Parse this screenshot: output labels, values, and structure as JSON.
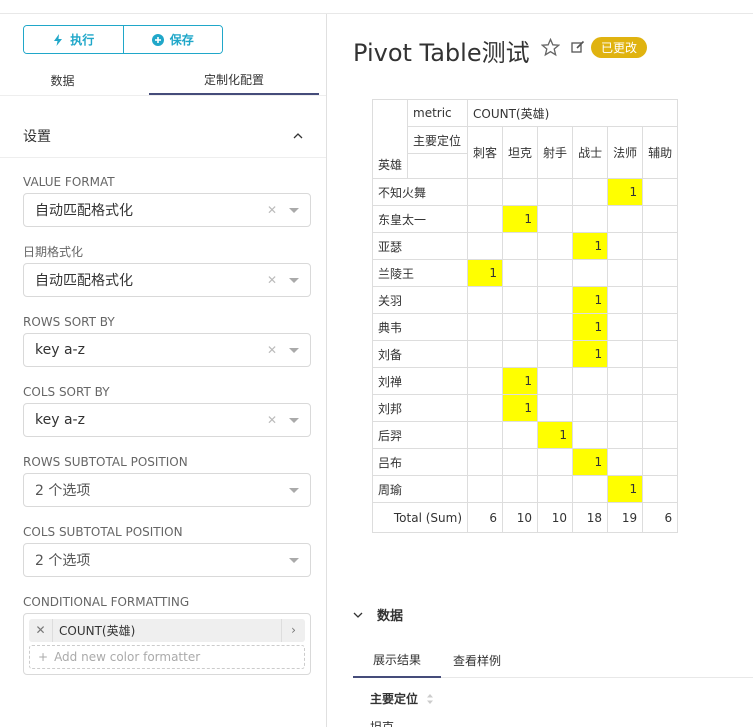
{
  "toolbar": {
    "run_label": "执行",
    "save_label": "保存"
  },
  "panel_tabs": {
    "data": "数据",
    "customize": "定制化配置"
  },
  "settings": {
    "title": "设置",
    "fields": [
      {
        "label": "VALUE FORMAT",
        "value": "自动匹配格式化"
      },
      {
        "label": "日期格式化",
        "value": "自动匹配格式化"
      },
      {
        "label": "ROWS SORT BY",
        "value": "key a-z"
      },
      {
        "label": "COLS SORT BY",
        "value": "key a-z"
      },
      {
        "label": "ROWS SUBTOTAL POSITION",
        "value": "2 个选项"
      },
      {
        "label": "COLS SUBTOTAL POSITION",
        "value": "2 个选项"
      }
    ],
    "conditional_formatting": {
      "label": "CONDITIONAL FORMATTING",
      "chip": "COUNT(英雄)",
      "add": "Add new color formatter"
    }
  },
  "chart": {
    "title": "Pivot Table测试",
    "badge": "已更改"
  },
  "pivot": {
    "metric_label": "metric",
    "metric_value": "COUNT(英雄)",
    "col_dim": "主要定位",
    "row_dim": "英雄",
    "columns": [
      "刺客",
      "坦克",
      "射手",
      "战士",
      "法师",
      "辅助"
    ],
    "rows": [
      {
        "name": "不知火舞",
        "values": [
          "",
          "",
          "",
          "",
          "1",
          ""
        ]
      },
      {
        "name": "东皇太一",
        "values": [
          "",
          "1",
          "",
          "",
          "",
          ""
        ]
      },
      {
        "name": "亚瑟",
        "values": [
          "",
          "",
          "",
          "1",
          "",
          ""
        ]
      },
      {
        "name": "兰陵王",
        "values": [
          "1",
          "",
          "",
          "",
          "",
          ""
        ]
      },
      {
        "name": "关羽",
        "values": [
          "",
          "",
          "",
          "1",
          "",
          ""
        ]
      },
      {
        "name": "典韦",
        "values": [
          "",
          "",
          "",
          "1",
          "",
          ""
        ]
      },
      {
        "name": "刘备",
        "values": [
          "",
          "",
          "",
          "1",
          "",
          ""
        ]
      },
      {
        "name": "刘禅",
        "values": [
          "",
          "1",
          "",
          "",
          "",
          ""
        ]
      },
      {
        "name": "刘邦",
        "values": [
          "",
          "1",
          "",
          "",
          "",
          ""
        ]
      },
      {
        "name": "后羿",
        "values": [
          "",
          "",
          "1",
          "",
          "",
          ""
        ]
      },
      {
        "name": "吕布",
        "values": [
          "",
          "",
          "",
          "1",
          "",
          ""
        ]
      },
      {
        "name": "周瑜",
        "values": [
          "",
          "",
          "",
          "",
          "1",
          ""
        ]
      }
    ],
    "total_label": "Total (Sum)",
    "totals": [
      "6",
      "10",
      "10",
      "18",
      "19",
      "6"
    ]
  },
  "data_section": {
    "title": "数据",
    "tabs": [
      "展示结果",
      "查看样例"
    ],
    "column_header": "主要定位",
    "first_cell": "坦克"
  },
  "colors": {
    "accent": "#20a7c9",
    "badge": "#e0b310",
    "highlight": "#ffff00",
    "tab_underline": "#454c7a"
  }
}
